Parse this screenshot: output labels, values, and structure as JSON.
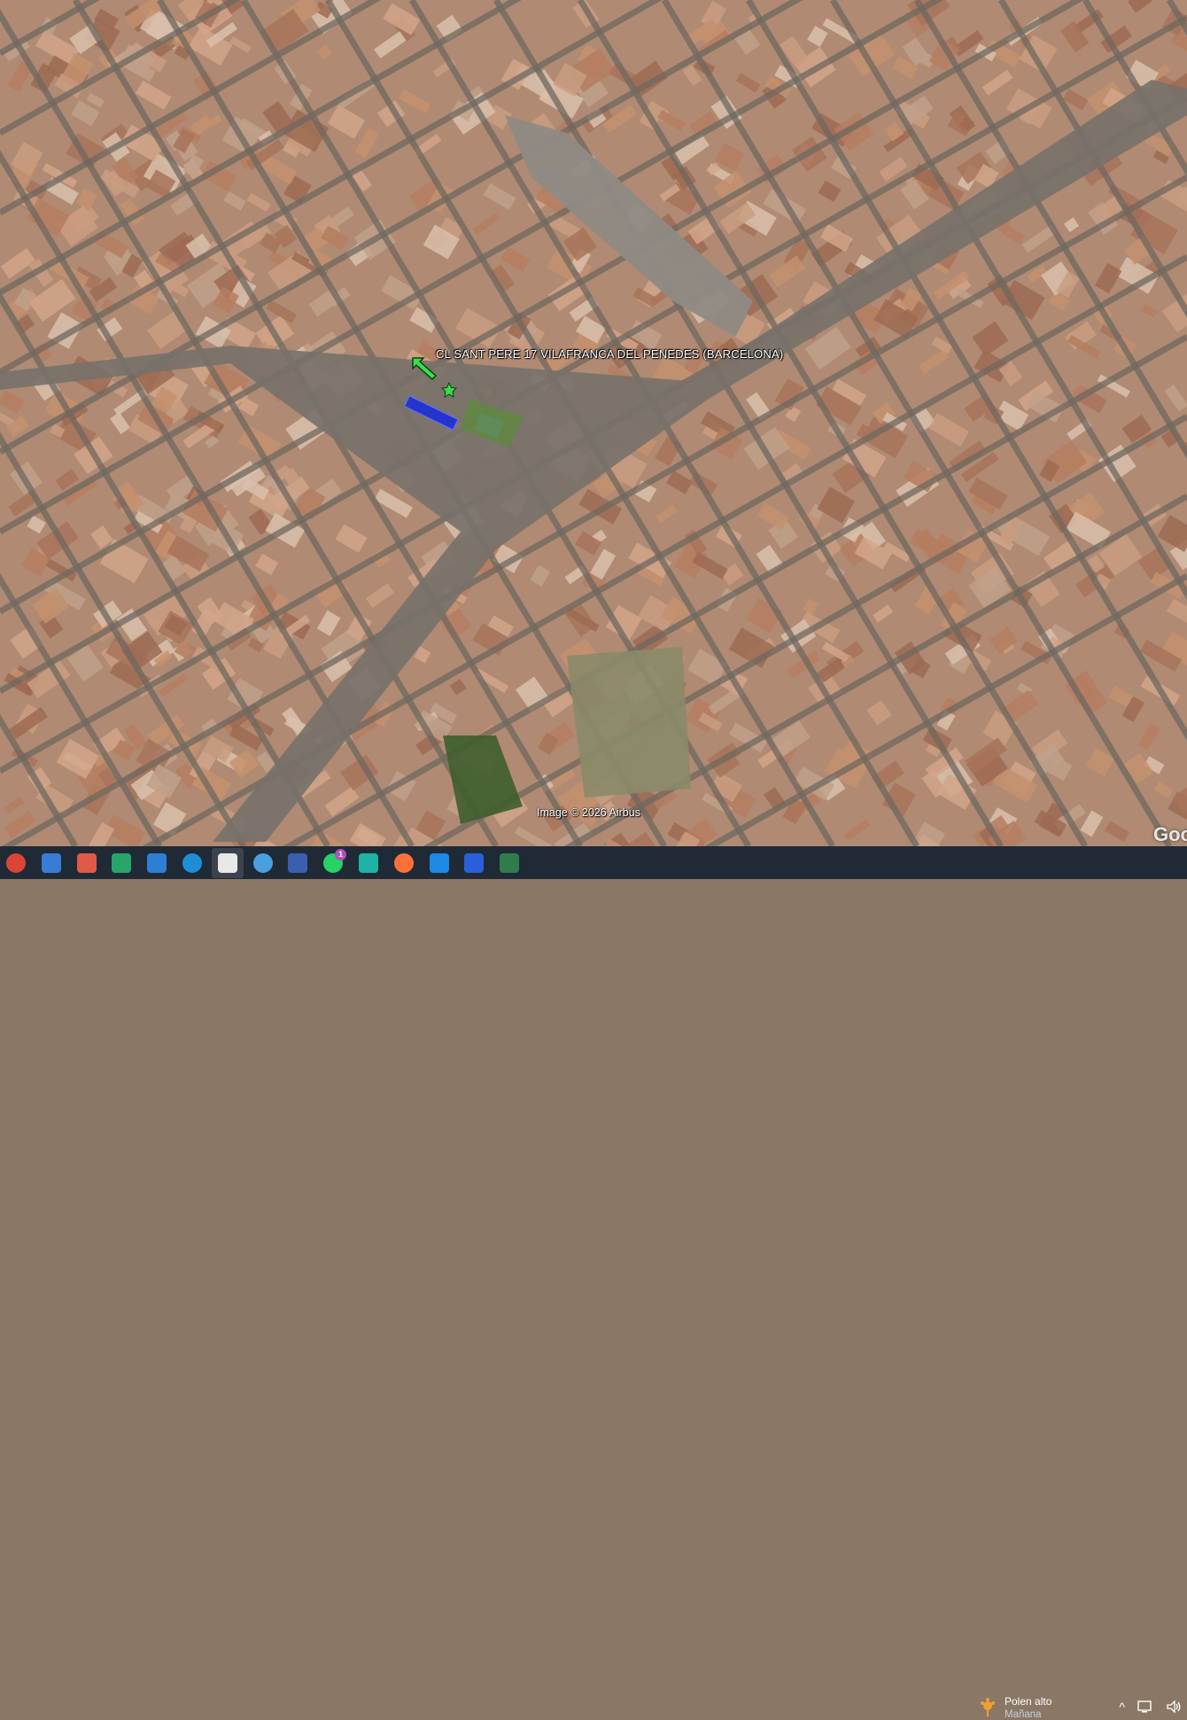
{
  "map": {
    "placemark_label": "CL SANT PERE  17  VILAFRANCA DEL PENEDES (BARCELONA)",
    "copyright": "Image © 2026 Airbus",
    "google_mark": "Goo",
    "placemark_icon": "green-star-icon",
    "arrow_icon": "green-arrow-icon",
    "colors": {
      "roof": "#b8866a",
      "street": "#6f6860",
      "plaza": "#9b958d",
      "highlight": "#1f2fd8",
      "marker": "#3cdc4c"
    }
  },
  "taskbar": {
    "apps": [
      {
        "name": "chrome-icon",
        "badge": ""
      },
      {
        "name": "image-viewer-icon",
        "badge": ""
      },
      {
        "name": "snipping-tool-icon",
        "badge": ""
      },
      {
        "name": "lock-folder-icon",
        "badge": ""
      },
      {
        "name": "photos-icon",
        "badge": ""
      },
      {
        "name": "edge-icon",
        "badge": ""
      },
      {
        "name": "blank-file-icon",
        "badge": ""
      },
      {
        "name": "google-earth-icon",
        "badge": ""
      },
      {
        "name": "floppy-save-icon",
        "badge": ""
      },
      {
        "name": "whatsapp-icon",
        "badge": "1"
      },
      {
        "name": "spiral-app-icon",
        "badge": ""
      },
      {
        "name": "firefox-icon",
        "badge": ""
      },
      {
        "name": "s-app-icon",
        "badge": ""
      },
      {
        "name": "a-app-icon",
        "badge": ""
      },
      {
        "name": "terminal-window-icon",
        "badge": ""
      }
    ],
    "weather": {
      "title": "Polen alto",
      "subtitle": "Mañana",
      "icon": "pollen-icon"
    },
    "tray": {
      "chevron": "^",
      "display_icon": "display-icon",
      "volume_icon": "volume-icon"
    }
  }
}
